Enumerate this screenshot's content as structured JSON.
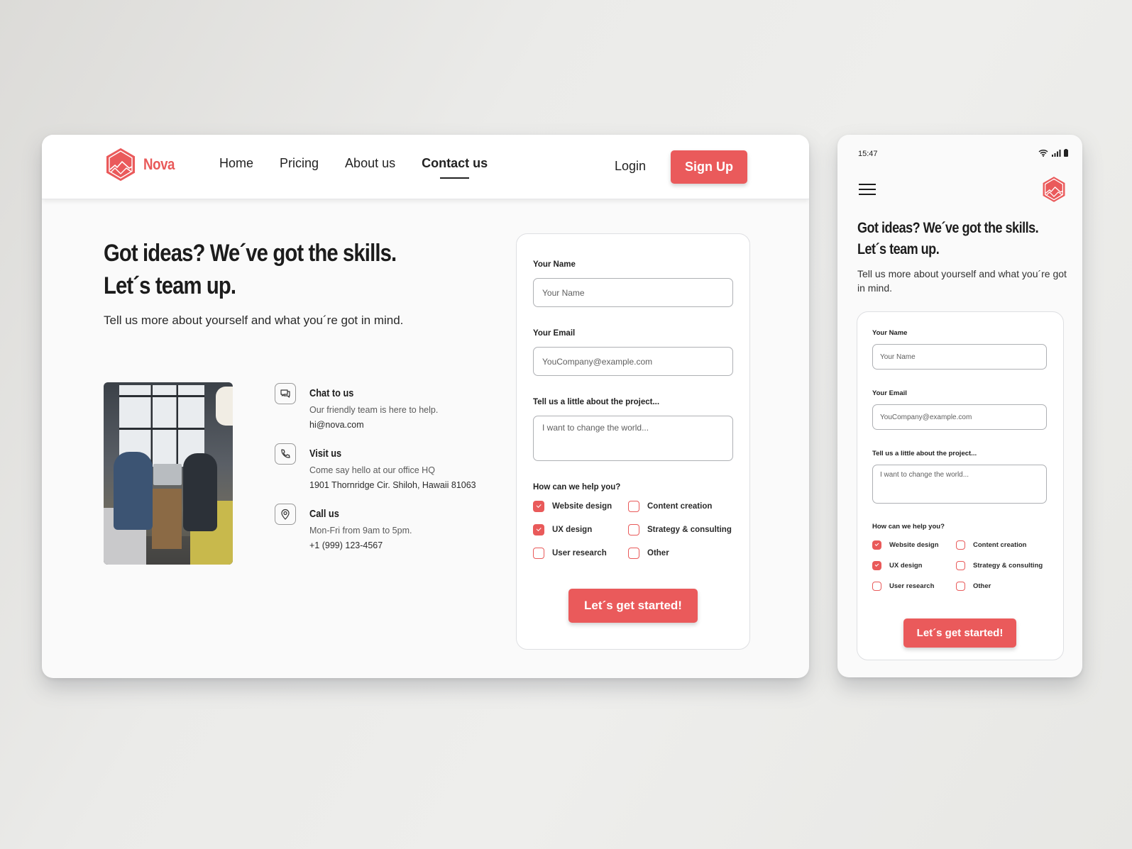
{
  "colors": {
    "accent": "#ea5a5b",
    "text": "#1f1f1f",
    "muted": "#5a5a5a"
  },
  "brand": {
    "name": "Nova",
    "logo_icon": "hexagon-mountain-logo"
  },
  "nav": {
    "links": [
      {
        "label": "Home",
        "active": false
      },
      {
        "label": "Pricing",
        "active": false
      },
      {
        "label": "About us",
        "active": false
      },
      {
        "label": "Contact us",
        "active": true
      }
    ],
    "login_label": "Login",
    "signup_label": "Sign Up"
  },
  "hero": {
    "title_line1": "Got ideas? We´ve got the skills.",
    "title_line2": "Let´s team up.",
    "subtitle": "Tell us more about yourself and what you´re got in mind."
  },
  "photo": {
    "alt": "Two people working at a laptop"
  },
  "contacts": [
    {
      "icon": "chat-icon",
      "title": "Chat to us",
      "line1": "Our friendly team is here to help.",
      "line2": "hi@nova.com"
    },
    {
      "icon": "phone-icon",
      "title": "Visit us",
      "line1": "Come say hello at our office HQ",
      "line2": "1901 Thornridge Cir. Shiloh, Hawaii 81063"
    },
    {
      "icon": "location-pin-icon",
      "title": "Call us",
      "line1": "Mon-Fri from 9am to 5pm.",
      "line2": "+1 (999) 123-4567"
    }
  ],
  "form": {
    "name_label": "Your Name",
    "name_placeholder": "Your Name",
    "name_value": "",
    "email_label": "Your Email",
    "email_placeholder": "YouCompany@example.com",
    "email_value": "",
    "project_label": "Tell us a little about the project...",
    "project_placeholder": "I want to change the world...",
    "project_value": "",
    "help_label": "How can we help you?",
    "options": [
      {
        "label": "Website design",
        "checked": true
      },
      {
        "label": "Content creation",
        "checked": false
      },
      {
        "label": "UX design",
        "checked": true
      },
      {
        "label": "Strategy & consulting",
        "checked": false
      },
      {
        "label": "User research",
        "checked": false
      },
      {
        "label": "Other",
        "checked": false
      }
    ],
    "submit_label": "Let´s get started!"
  },
  "mobile": {
    "status_time": "15:47",
    "status_icons": [
      "wifi-icon",
      "signal-icon",
      "battery-icon"
    ],
    "menu_icon": "hamburger-menu-icon",
    "title_line1": "Got ideas? We´ve got the skills.",
    "title_line2": "Let´s team up.",
    "subtitle": "Tell us more about yourself and what you´re got in mind."
  }
}
